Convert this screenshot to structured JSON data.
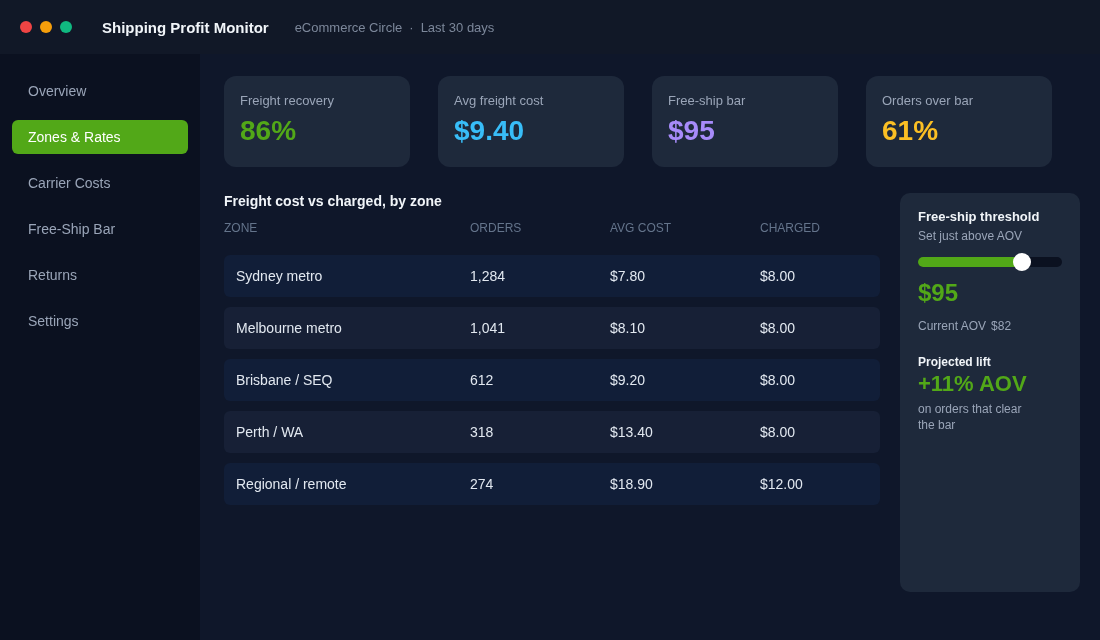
{
  "window": {
    "title": "Shipping Profit Monitor",
    "subtitle": "eCommerce Circle",
    "period": "Last 30 days",
    "separator": "·"
  },
  "sidebar": {
    "items": [
      {
        "label": "Overview",
        "selected": false
      },
      {
        "label": "Zones & Rates",
        "selected": true
      },
      {
        "label": "Carrier Costs",
        "selected": false
      },
      {
        "label": "Free-Ship Bar",
        "selected": false
      },
      {
        "label": "Returns",
        "selected": false
      },
      {
        "label": "Settings",
        "selected": false
      }
    ]
  },
  "stats": [
    {
      "label": "Freight recovery",
      "value": "86%",
      "color": "#52a818"
    },
    {
      "label": "Avg freight cost",
      "value": "$9.40",
      "color": "#38bdf8"
    },
    {
      "label": "Free-ship bar",
      "value": "$95",
      "color": "#a78bfa"
    },
    {
      "label": "Orders over bar",
      "value": "61%",
      "color": "#fbbf24"
    }
  ],
  "table": {
    "title": "Freight cost vs charged, by zone",
    "columns": [
      "ZONE",
      "ORDERS",
      "AVG COST",
      "CHARGED"
    ],
    "rows": [
      [
        "Sydney metro",
        "1,284",
        "$7.80",
        "$8.00"
      ],
      [
        "Melbourne metro",
        "1,041",
        "$8.10",
        "$8.00"
      ],
      [
        "Brisbane / SEQ",
        "612",
        "$9.20",
        "$8.00"
      ],
      [
        "Perth / WA",
        "318",
        "$13.40",
        "$8.00"
      ],
      [
        "Regional / remote",
        "274",
        "$18.90",
        "$12.00"
      ]
    ]
  },
  "threshold": {
    "title": "Free-ship threshold",
    "subtitle": "Set just above AOV",
    "level": 0.72,
    "value": "$95",
    "current_label": "Current AOV",
    "current_value": "$82",
    "lift_label": "Projected lift",
    "lift_value": "+11% AOV",
    "lift_note": "on orders that clear the bar"
  }
}
